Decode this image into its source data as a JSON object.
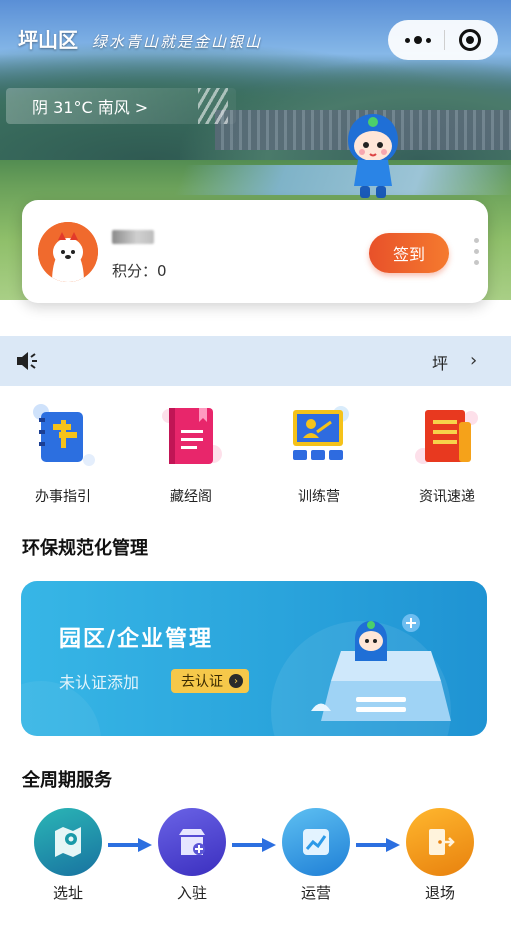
{
  "banner": {
    "district": "坪山区",
    "slogan": "绿水青山就是金山银山",
    "weather": "阴 31°C 南风 >"
  },
  "profile": {
    "points_label": "积分：0",
    "checkin_label": "签到"
  },
  "notice": {
    "text": "坪",
    "arrow": "›"
  },
  "quick_menu": [
    {
      "label": "办事指引",
      "icon": "guide-icon"
    },
    {
      "label": "藏经阁",
      "icon": "book-icon"
    },
    {
      "label": "训练营",
      "icon": "training-icon"
    },
    {
      "label": "资讯速递",
      "icon": "news-icon"
    }
  ],
  "section_env": "环保规范化管理",
  "park_card": {
    "title": "园区/企业管理",
    "subtitle": "未认证添加",
    "button": "去认证"
  },
  "section_lifecycle": "全周期服务",
  "lifecycle": [
    {
      "label": "选址",
      "icon": "map-pin-icon",
      "color": "#1a9aa8"
    },
    {
      "label": "入驻",
      "icon": "store-icon",
      "color": "#5a55d6"
    },
    {
      "label": "运营",
      "icon": "chart-icon",
      "color": "#2d9ae8"
    },
    {
      "label": "退场",
      "icon": "exit-door-icon",
      "color": "#f29a1a"
    }
  ],
  "colors": {
    "accent_orange": "#e8512a",
    "notice_bg": "#dbe8f6",
    "park_blue": "#2aa4dc"
  }
}
